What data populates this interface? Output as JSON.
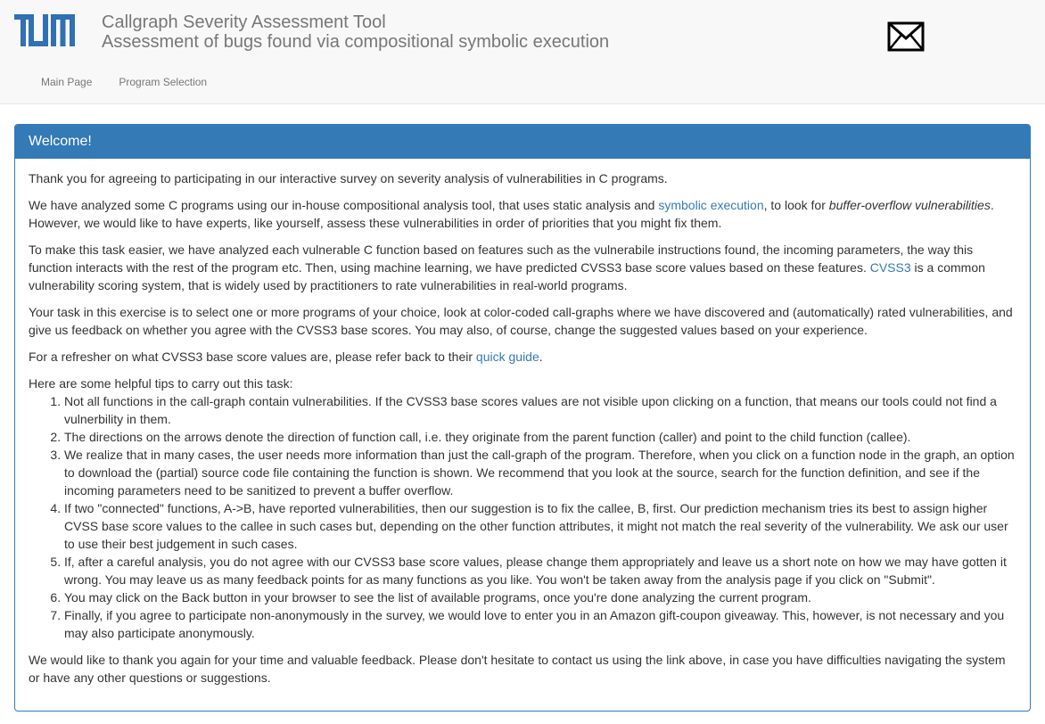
{
  "header": {
    "title": "Callgraph Severity Assessment Tool",
    "subtitle": "Assessment of bugs found via compositional symbolic execution",
    "logo_text": "TUM"
  },
  "nav": [
    {
      "label": "Main Page"
    },
    {
      "label": "Program Selection"
    }
  ],
  "panel": {
    "heading": "Welcome!",
    "p1": "Thank you for agreeing to participating in our interactive survey on severity analysis of vulnerabilities in C programs.",
    "p2": {
      "part1": "We have analyzed some C programs using our in-house compositional analysis tool, that uses static analysis and ",
      "link": "symbolic execution",
      "part2": ", to look for ",
      "emphasis": "buffer-overflow vulnerabilities",
      "part3": ". However, we would like to have experts, like yourself, assess these vulnerabilities in order of priorities that you might fix them."
    },
    "p3": {
      "part1": "To make this task easier, we have analyzed each vulnerable C function based on features such as the vulnerabile instructions found, the incoming parameters, the way this function interacts with the rest of the program etc. Then, using machine learning, we have predicted CVSS3 base score values based on these features. ",
      "link": "CVSS3",
      "part2": " is a common vulnerability scoring system, that is widely used by practitioners to rate vulnerabilities in real-world programs."
    },
    "p4": "Your task in this exercise is to select one or more programs of your choice, look at color-coded call-graphs where we have discovered and (automatically) rated vulnerabilities, and give us feedback on whether you agree with the CVSS3 base scores. You may also, of course, change the suggested values based on your experience.",
    "p5": {
      "part1": "For a refresher on what CVSS3 base score values are, please refer back to their ",
      "link": "quick guide",
      "part2": "."
    },
    "tips_intro": "Here are some helpful tips to carry out this task:",
    "tips": [
      "Not all functions in the call-graph contain vulnerabilities. If the CVSS3 base scores values are not visible upon clicking on a function, that means our tools could not find a vulnerbility in them.",
      "The directions on the arrows denote the direction of function call, i.e. they originate from the parent function (caller) and point to the child function (callee).",
      "We realize that in many cases, the user needs more information than just the call-graph of the program. Therefore, when you click on a function node in the graph, an option to download the (partial) source code file containing the function is shown. We recommend that you look at the source, search for the function definition, and see if the incoming parameters need to be sanitized to prevent a buffer overflow.",
      "If two \"connected\" functions, A->B, have reported vulnerabilities, then our suggestion is to fix the callee, B, first. Our prediction mechanism tries its best to assign higher CVSS base score values to the callee in such cases but, depending on the other function attributes, it might not match the real severity of the vulnerability. We ask our user to use their best judgement in such cases.",
      "If, after a careful analysis, you do not agree with our CVSS3 base score values, please change them appropriately and leave us a short note on how we may have gotten it wrong. You may leave us as many feedback points for as many functions as you like. You won't be taken away from the analysis page if you click on \"Submit\".",
      "You may click on the Back button in your browser to see the list of available programs, once you're done analyzing the current program.",
      "Finally, if you agree to participate non-anonymously in the survey, we would love to enter you in an Amazon gift-coupon giveaway. This, however, is not necessary and you may also participate anonymously."
    ],
    "closing": "We would like to thank you again for your time and valuable feedback. Please don't hesitate to contact us using the link above, in case you have difficulties navigating the system or have any other questions or suggestions."
  },
  "colors": {
    "primary": "#337ab7",
    "header_bg": "#f8f8f8",
    "logo": "#3070b3",
    "text": "#333333",
    "muted": "#777777"
  }
}
